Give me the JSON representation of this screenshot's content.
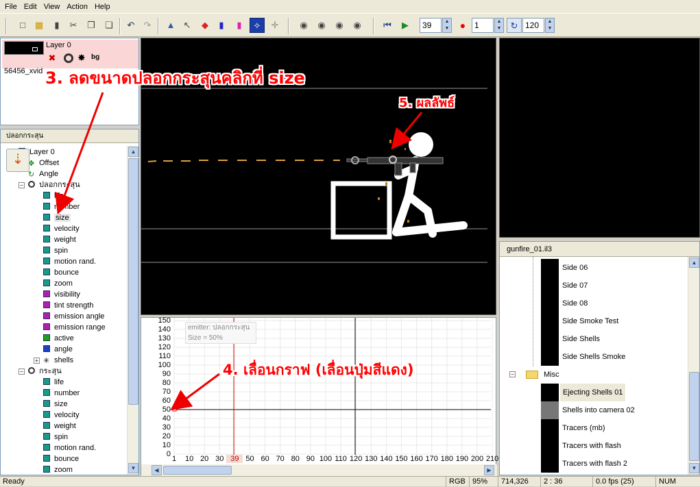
{
  "menu": [
    "File",
    "Edit",
    "View",
    "Action",
    "Help"
  ],
  "toolbar": {
    "frame_value": "39",
    "record_value": "1",
    "loop_value": "120"
  },
  "layer_panel": {
    "layer_name": "Layer 0",
    "clip_name": "56456_xvid",
    "bg_label": "bg"
  },
  "tree_panel": {
    "title": "ปลอกกระสุน",
    "items": [
      {
        "label": "Layer 0",
        "level": 0,
        "icon": "layer"
      },
      {
        "label": "Offset",
        "level": 1,
        "icon": "move"
      },
      {
        "label": "Angle",
        "level": 1,
        "icon": "angle"
      },
      {
        "label": "ปลอกกระสุน",
        "level": 1,
        "icon": "emitter"
      },
      {
        "label": "life",
        "level": 2,
        "icon": "prop",
        "color": "#1a9a8a"
      },
      {
        "label": "number",
        "level": 2,
        "icon": "prop",
        "color": "#1a9a8a"
      },
      {
        "label": "size",
        "level": 2,
        "icon": "prop",
        "color": "#1a9a8a",
        "selected": true
      },
      {
        "label": "velocity",
        "level": 2,
        "icon": "prop",
        "color": "#1a9a8a"
      },
      {
        "label": "weight",
        "level": 2,
        "icon": "prop",
        "color": "#1a9a8a"
      },
      {
        "label": "spin",
        "level": 2,
        "icon": "prop",
        "color": "#1a9a8a"
      },
      {
        "label": "motion rand.",
        "level": 2,
        "icon": "prop",
        "color": "#1a9a8a"
      },
      {
        "label": "bounce",
        "level": 2,
        "icon": "prop",
        "color": "#1a9a8a"
      },
      {
        "label": "zoom",
        "level": 2,
        "icon": "prop",
        "color": "#1a9a8a"
      },
      {
        "label": "visibility",
        "level": 2,
        "icon": "prop",
        "color": "#b020b0"
      },
      {
        "label": "tint strength",
        "level": 2,
        "icon": "prop",
        "color": "#b020b0"
      },
      {
        "label": "emission angle",
        "level": 2,
        "icon": "prop",
        "color": "#b020b0"
      },
      {
        "label": "emission range",
        "level": 2,
        "icon": "prop",
        "color": "#b020b0"
      },
      {
        "label": "active",
        "level": 2,
        "icon": "prop",
        "color": "#20a020"
      },
      {
        "label": "angle",
        "level": 2,
        "icon": "prop",
        "color": "#2040c0"
      },
      {
        "label": "shells",
        "level": 2,
        "icon": "particle"
      },
      {
        "label": "กระสุน",
        "level": 1,
        "icon": "emitter"
      },
      {
        "label": "life",
        "level": 2,
        "icon": "prop",
        "color": "#1a9a8a"
      },
      {
        "label": "number",
        "level": 2,
        "icon": "prop",
        "color": "#1a9a8a"
      },
      {
        "label": "size",
        "level": 2,
        "icon": "prop",
        "color": "#1a9a8a"
      },
      {
        "label": "velocity",
        "level": 2,
        "icon": "prop",
        "color": "#1a9a8a"
      },
      {
        "label": "weight",
        "level": 2,
        "icon": "prop",
        "color": "#1a9a8a"
      },
      {
        "label": "spin",
        "level": 2,
        "icon": "prop",
        "color": "#1a9a8a"
      },
      {
        "label": "motion rand.",
        "level": 2,
        "icon": "prop",
        "color": "#1a9a8a"
      },
      {
        "label": "bounce",
        "level": 2,
        "icon": "prop",
        "color": "#1a9a8a"
      },
      {
        "label": "zoom",
        "level": 2,
        "icon": "prop",
        "color": "#1a9a8a"
      }
    ]
  },
  "graph": {
    "info_emitter": "emitter:  ปลอกกระสุน",
    "info_size": "Size = 50%",
    "y_ticks": [
      "150",
      "140",
      "130",
      "120",
      "110",
      "100",
      "90",
      "80",
      "70",
      "60",
      "50",
      "40",
      "30",
      "20",
      "10",
      "0"
    ],
    "x_ticks": [
      "1",
      "10",
      "20",
      "30",
      "39",
      "50",
      "60",
      "70",
      "80",
      "90",
      "100",
      "110",
      "120",
      "130",
      "140",
      "150",
      "160",
      "170",
      "180",
      "190",
      "200",
      "210"
    ],
    "current_frame": "39"
  },
  "library": {
    "title": "gunfire_01.il3",
    "items": [
      {
        "label": "Side 06"
      },
      {
        "label": "Side 07"
      },
      {
        "label": "Side 08"
      },
      {
        "label": "Side Smoke Test"
      },
      {
        "label": "Side Shells"
      },
      {
        "label": "Side Shells Smoke"
      },
      {
        "label": "Misc",
        "folder": true
      },
      {
        "label": "Ejecting Shells 01",
        "selected": true
      },
      {
        "label": "Shells into camera 02"
      },
      {
        "label": "Tracers (mb)"
      },
      {
        "label": "Tracers with flash"
      },
      {
        "label": "Tracers with flash 2"
      }
    ]
  },
  "annotations": {
    "step3": "3. ลดขนาดปลอกกระสุนคลิกที่ size",
    "step4": "4. เลื่อนกราฟ (เลื่อนปุ่มสีแดง)",
    "step5": "5. ผลลัพธ์"
  },
  "status": {
    "ready": "Ready",
    "mode": "RGB",
    "zoom": "95%",
    "coords": "714,326",
    "time": "2 : 36",
    "fps": "0.0 fps (25)",
    "num": "NUM"
  }
}
